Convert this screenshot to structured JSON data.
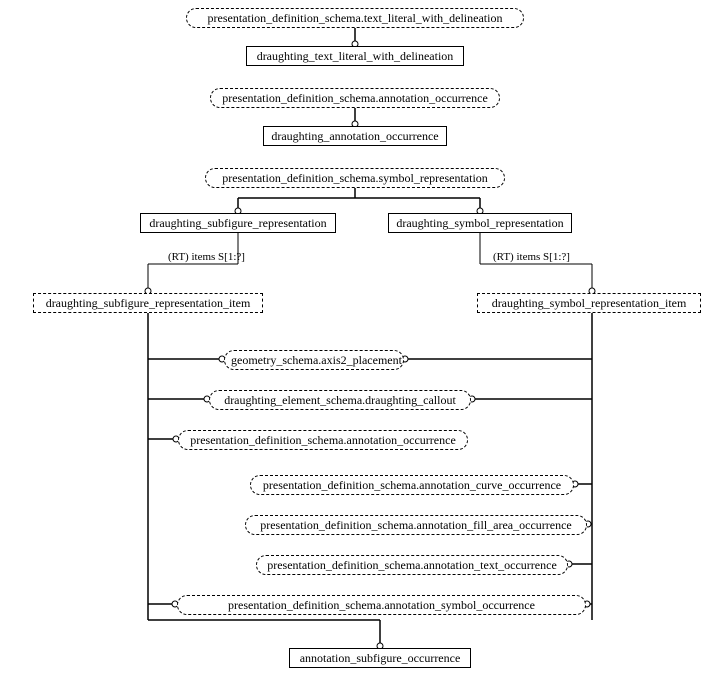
{
  "diagram": {
    "type": "express-g",
    "title": "",
    "nodes": {
      "n1": "presentation_definition_schema.text_literal_with_delineation",
      "n2": "draughting_text_literal_with_delineation",
      "n3": "presentation_definition_schema.annotation_occurrence",
      "n4": "draughting_annotation_occurrence",
      "n5": "presentation_definition_schema.symbol_representation",
      "n6": "draughting_subfigure_representation",
      "n7": "draughting_symbol_representation",
      "n8": "draughting_subfigure_representation_item",
      "n9": "draughting_symbol_representation_item",
      "n10": "geometry_schema.axis2_placement",
      "n11": "draughting_element_schema.draughting_callout",
      "n12": "presentation_definition_schema.annotation_occurrence",
      "n13": "presentation_definition_schema.annotation_curve_occurrence",
      "n14": "presentation_definition_schema.annotation_fill_area_occurrence",
      "n15": "presentation_definition_schema.annotation_text_occurrence",
      "n16": "presentation_definition_schema.annotation_symbol_occurrence",
      "n17": "annotation_subfigure_occurrence"
    },
    "edge_labels": {
      "rt_left": "(RT) items S[1:?]",
      "rt_right": "(RT) items S[1:?]"
    }
  }
}
